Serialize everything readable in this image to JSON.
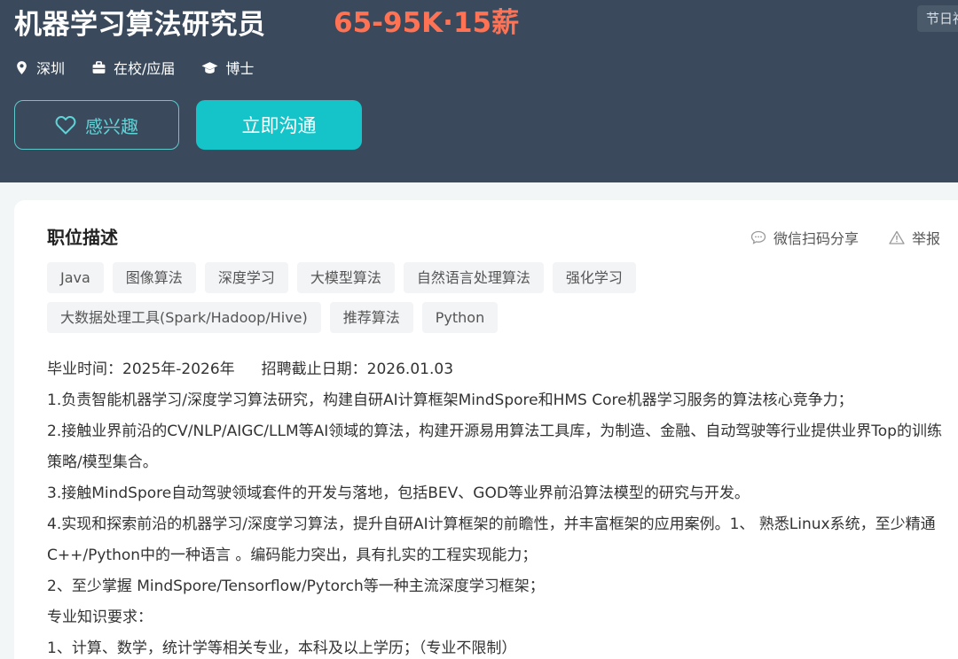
{
  "header": {
    "job_title": "机器学习算法研究员",
    "salary": "65-95K·15薪",
    "holiday_badge": "节日福利",
    "meta": {
      "location": "深圳",
      "experience": "在校/应届",
      "degree": "博士"
    },
    "buttons": {
      "interest": "感兴趣",
      "chat": "立即沟通"
    }
  },
  "description": {
    "title": "职位描述",
    "share": "微信扫码分享",
    "report": "举报",
    "tags": [
      "Java",
      "图像算法",
      "深度学习",
      "大模型算法",
      "自然语言处理算法",
      "强化学习",
      "大数据处理工具(Spark/Hadoop/Hive)",
      "推荐算法",
      "Python"
    ],
    "graduation": "毕业时间：2025年-2026年",
    "deadline": "招聘截止日期：2026.01.03",
    "lines": [
      "1.负责智能机器学习/深度学习算法研究，构建自研AI计算框架MindSpore和HMS Core机器学习服务的算法核心竞争力；",
      "2.接触业界前沿的CV/NLP/AIGC/LLM等AI领域的算法，构建开源易用算法工具库，为制造、金融、自动驾驶等行业提供业界Top的训练策略/模型集合。",
      "3.接触MindSpore自动驾驶领域套件的开发与落地，包括BEV、GOD等业界前沿算法模型的研究与开发。",
      "4.实现和探索前沿的机器学习/深度学习算法，提升自研AI计算框架的前瞻性，并丰富框架的应用案例。1、 熟悉Linux系统，至少精通C++/Python中的一种语言 。编码能力突出，具有扎实的工程实现能力；",
      "2、至少掌握 MindSpore/Tensorflow/Pytorch等一种主流深度学习框架；",
      "专业知识要求：",
      "1、计算、数学，统计学等相关专业，本科及以上学历；（专业不限制）"
    ]
  },
  "colors": {
    "header_bg": "#3a4a5c",
    "salary": "#ff7254",
    "accent": "#14c4c8",
    "page_bg": "#f2f6f7"
  },
  "icons": {
    "location": "map-pin-icon",
    "experience": "briefcase-icon",
    "degree": "graduation-cap-icon",
    "interest": "heart-icon",
    "share": "chat-bubble-icon",
    "report": "warning-triangle-icon"
  }
}
